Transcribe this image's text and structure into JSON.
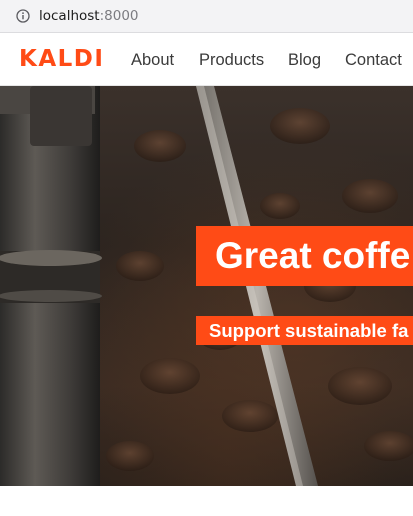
{
  "browser": {
    "url_host": "localhost",
    "url_port": ":8000"
  },
  "site": {
    "logo": "KALDI",
    "nav": [
      "About",
      "Products",
      "Blog",
      "Contact"
    ],
    "brand_color": "#ff4b16"
  },
  "hero": {
    "headline": "Great coffe",
    "subheading": "Support sustainable fa"
  }
}
